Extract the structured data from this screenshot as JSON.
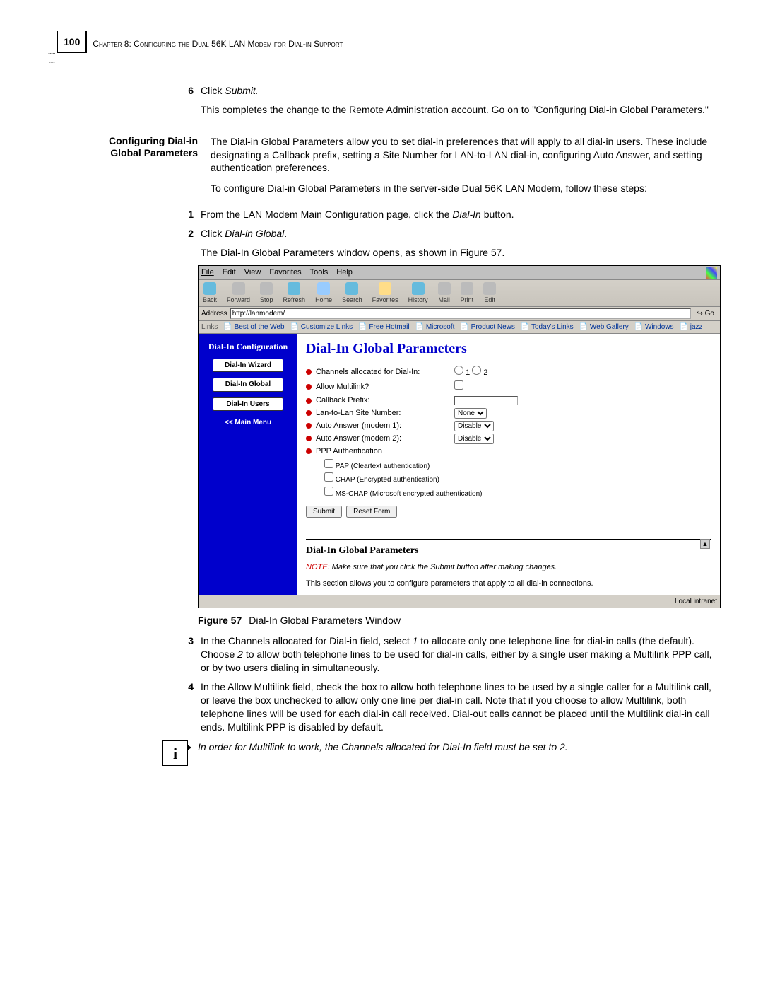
{
  "header": {
    "page_number": "100",
    "chapter_text": "Chapter 8: Configuring the Dual 56K LAN Modem for Dial-in Support"
  },
  "step6": {
    "num": "6",
    "line1_prefix": "Click ",
    "line1_em": "Submit.",
    "para2": "This completes the change to the Remote Administration account. Go on to \"Configuring Dial-in Global Parameters.\""
  },
  "section": {
    "heading_line1": "Configuring Dial-in",
    "heading_line2": "Global Parameters",
    "intro": "The Dial-in Global Parameters allow you to set dial-in preferences that will apply to all dial-in users. These include designating a Callback prefix, setting a Site Number for LAN-to-LAN dial-in, configuring Auto Answer, and setting authentication preferences.",
    "intro2": "To configure Dial-in Global Parameters in the server-side Dual 56K LAN Modem, follow these steps:"
  },
  "step1": {
    "num": "1",
    "text_prefix": "From the LAN Modem Main Configuration page, click the ",
    "text_em": "Dial-In",
    "text_suffix": " button."
  },
  "step2": {
    "num": "2",
    "text_prefix": "Click ",
    "text_em": "Dial-in Global",
    "text_suffix": ".",
    "para2": "The Dial-In Global Parameters window opens, as shown in Figure 57."
  },
  "ie": {
    "menu": {
      "file": "File",
      "edit": "Edit",
      "view": "View",
      "fav": "Favorites",
      "tools": "Tools",
      "help": "Help"
    },
    "toolbar": {
      "back": "Back",
      "forward": "Forward",
      "stop": "Stop",
      "refresh": "Refresh",
      "home": "Home",
      "search": "Search",
      "favorites": "Favorites",
      "history": "History",
      "mail": "Mail",
      "print": "Print",
      "edit": "Edit"
    },
    "address_label": "Address",
    "address_value": "http://lanmodem/",
    "go_label": "Go",
    "links_label": "Links",
    "links": [
      "Best of the Web",
      "Customize Links",
      "Free Hotmail",
      "Microsoft",
      "Product News",
      "Today's Links",
      "Web Gallery",
      "Windows",
      "jazz"
    ],
    "sidebar": {
      "title": "Dial-In Configuration",
      "btn_wizard": "Dial-In Wizard",
      "btn_global": "Dial-In Global",
      "btn_users": "Dial-In Users",
      "btn_main": "<< Main Menu"
    },
    "main": {
      "h1": "Dial-In Global Parameters",
      "row_channels": "Channels allocated for Dial-In:",
      "ch_opt1": "1",
      "ch_opt2": "2",
      "row_multilink": "Allow Multilink?",
      "row_callback": "Callback Prefix:",
      "row_lansite": "Lan-to-Lan Site Number:",
      "lansite_val": "None",
      "row_auto1": "Auto Answer (modem 1):",
      "auto1_val": "Disable",
      "row_auto2": "Auto Answer (modem 2):",
      "auto2_val": "Disable",
      "row_ppp": "PPP Authentication",
      "auth_pap": "PAP (Cleartext authentication)",
      "auth_chap": "CHAP (Encrypted authentication)",
      "auth_mschap": "MS-CHAP (Microsoft encrypted authentication)",
      "btn_submit": "Submit",
      "btn_reset": "Reset Form",
      "h2": "Dial-In Global Parameters",
      "note_label": "NOTE:",
      "note_text": " Make sure that you click the Submit button after making changes.",
      "help_text": "This section allows you to configure parameters that apply to all dial-in connections."
    },
    "status_right": "Local intranet"
  },
  "figure": {
    "label": "Figure 57",
    "caption": "Dial-In Global Parameters Window"
  },
  "step3": {
    "num": "3",
    "text": "In the Channels allocated for Dial-in field, select 1 to allocate only one telephone line for dial-in calls (the default). Choose 2 to allow both telephone lines to be used for dial-in calls, either by a single user making a Multilink PPP call, or by two users dialing in simultaneously."
  },
  "step4": {
    "num": "4",
    "text": "In the Allow Multilink field, check the box to allow both telephone lines to be used by a single caller for a Multilink call, or leave the box unchecked to allow only one line per dial-in call. Note that if you choose to allow Multilink, both telephone lines will be used for each dial-in call received. Dial-out calls cannot be placed until the Multilink dial-in call ends. Multilink PPP is disabled by default."
  },
  "info_note": {
    "text": "In order for Multilink to work, the Channels allocated for Dial-In field must be set to 2."
  }
}
